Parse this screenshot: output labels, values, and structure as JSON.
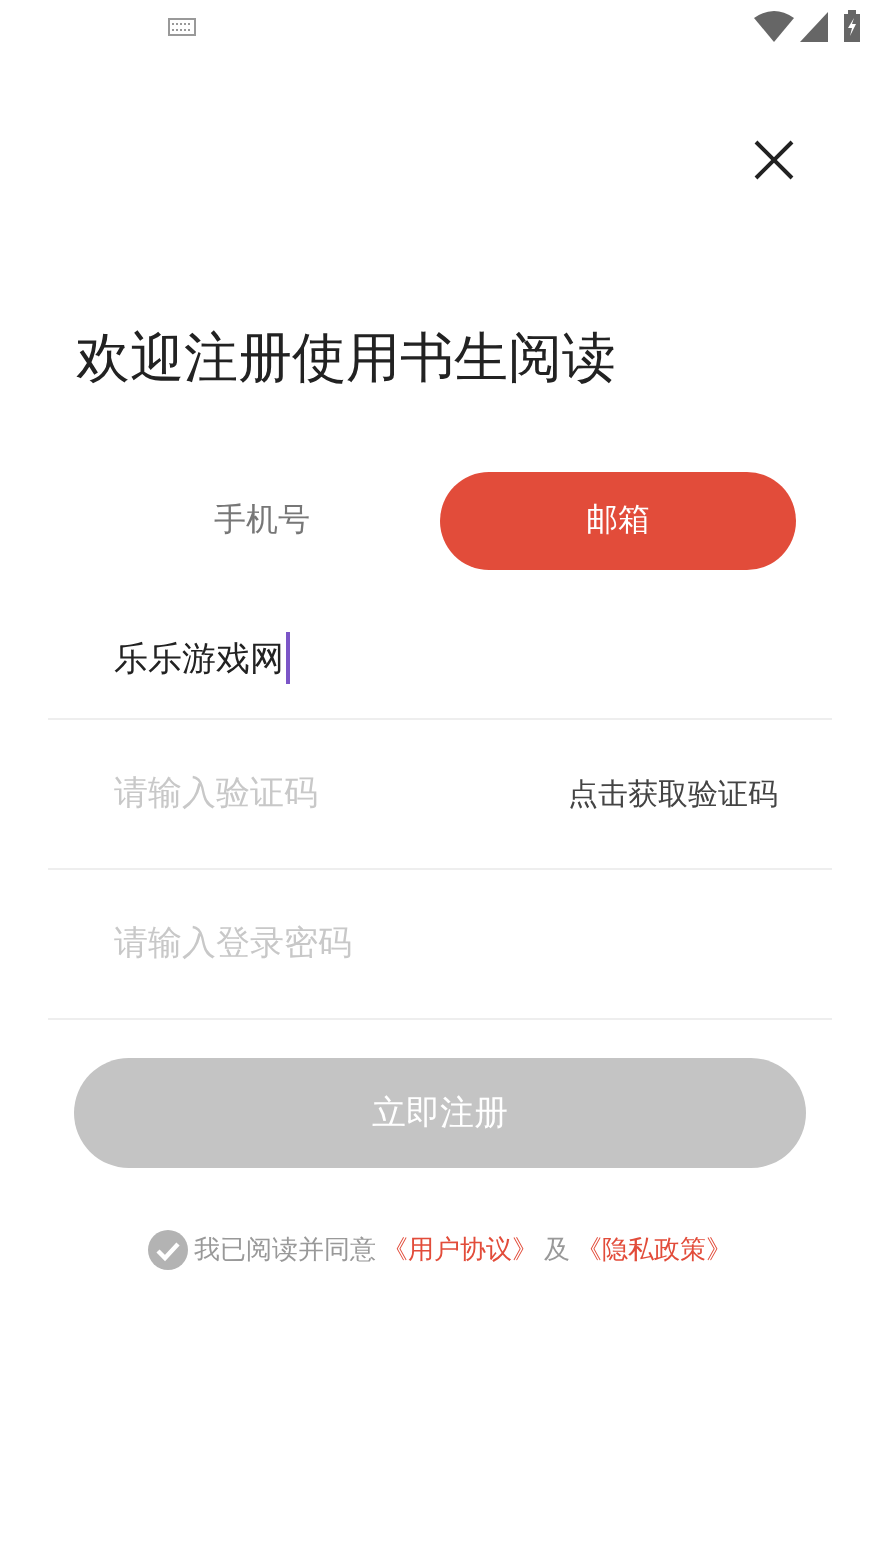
{
  "title": "欢迎注册使用书生阅读",
  "tabs": [
    {
      "label": "手机号",
      "selected": false
    },
    {
      "label": "邮箱",
      "selected": true
    }
  ],
  "fields": [
    {
      "kind": "text",
      "value": "乐乐游戏网",
      "focused": true
    },
    {
      "kind": "code",
      "placeholder": "请输入验证码",
      "action": "点击获取验证码"
    },
    {
      "kind": "password",
      "placeholder": "请输入登录密码"
    }
  ],
  "submit": {
    "label": "立即注册",
    "disabled": true
  },
  "agreement": {
    "checked": false,
    "text": "我已阅读并同意",
    "link_1": "《用户协议》",
    "joiner": "及",
    "link_2": "《隐私政策》"
  }
}
